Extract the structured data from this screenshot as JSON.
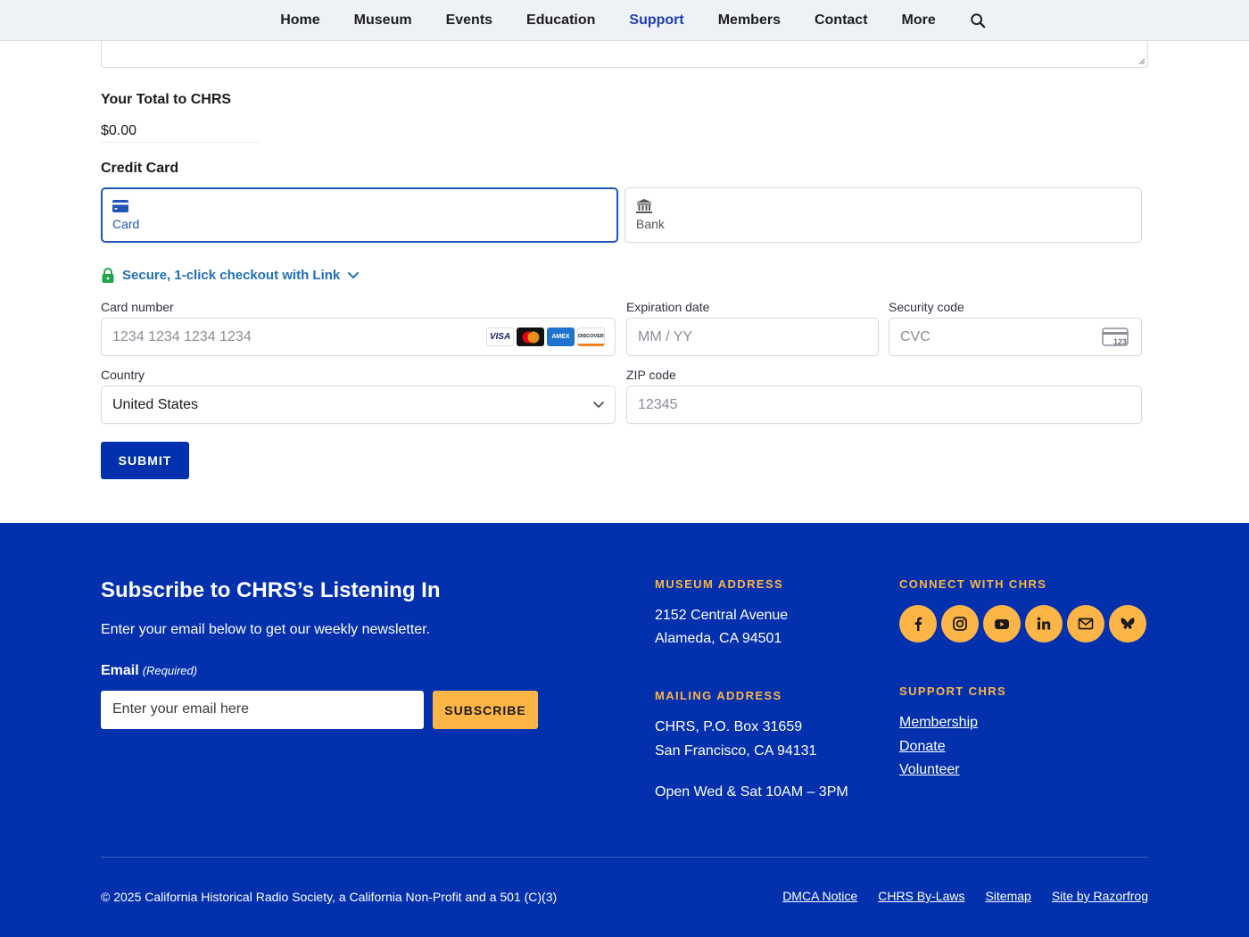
{
  "nav": {
    "items": [
      {
        "label": "Home",
        "active": false
      },
      {
        "label": "Museum",
        "active": false
      },
      {
        "label": "Events",
        "active": false
      },
      {
        "label": "Education",
        "active": false
      },
      {
        "label": "Support",
        "active": true
      },
      {
        "label": "Members",
        "active": false
      },
      {
        "label": "Contact",
        "active": false
      },
      {
        "label": "More",
        "active": false
      }
    ],
    "search_icon": "search-icon"
  },
  "form": {
    "total_label": "Your Total to CHRS",
    "total_value": "$0.00",
    "payment_heading": "Credit Card",
    "methods": [
      {
        "label": "Card",
        "icon": "credit-card-icon",
        "selected": true
      },
      {
        "label": "Bank",
        "icon": "bank-icon",
        "selected": false
      }
    ],
    "link_checkout": "Secure, 1-click checkout with Link",
    "card_number_label": "Card number",
    "card_number_placeholder": "1234 1234 1234 1234",
    "brands": [
      "VISA",
      "Mastercard",
      "AMEX",
      "DISCOVER"
    ],
    "expiration_label": "Expiration date",
    "expiration_placeholder": "MM / YY",
    "security_label": "Security code",
    "security_placeholder": "CVC",
    "cvc_icon_text": "123",
    "country_label": "Country",
    "country_value": "United States",
    "zip_label": "ZIP code",
    "zip_placeholder": "12345",
    "submit_label": "SUBMIT"
  },
  "footer": {
    "newsletter_title": "Subscribe to CHRS’s Listening In",
    "newsletter_desc": "Enter your email below to get our weekly newsletter.",
    "email_label": "Email",
    "email_required": "(Required)",
    "email_placeholder": "Enter your email here",
    "subscribe_label": "SUBSCRIBE",
    "museum_heading": "MUSEUM ADDRESS",
    "museum_line1": "2152 Central Avenue",
    "museum_line2": "Alameda, CA 94501",
    "mailing_heading": "MAILING ADDRESS",
    "mailing_line1": "CHRS, P.O. Box 31659",
    "mailing_line2": "San Francisco, CA 94131",
    "hours": "Open Wed & Sat 10AM – 3PM",
    "connect_heading": "CONNECT WITH CHRS",
    "social": [
      "facebook-icon",
      "instagram-icon",
      "youtube-icon",
      "linkedin-icon",
      "mail-icon",
      "bluesky-icon"
    ],
    "support_heading": "SUPPORT CHRS",
    "support_links": [
      "Membership",
      "Donate",
      "Volunteer"
    ],
    "copyright": "© 2025 California Historical Radio Society, a California Non-Profit and a 501 (C)(3)",
    "bottom_links": [
      "DMCA Notice",
      "CHRS By-Laws",
      "Sitemap",
      "Site by Razorfrog"
    ],
    "accent_color": "#fdb548",
    "background_color": "#0331ad"
  }
}
